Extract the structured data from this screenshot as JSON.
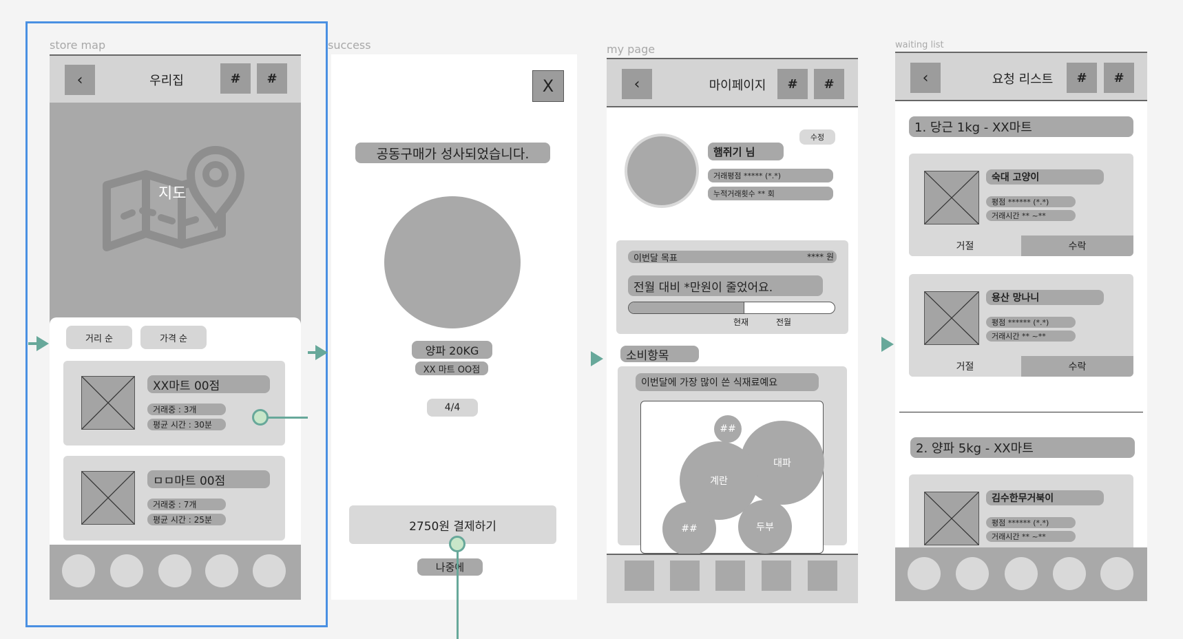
{
  "frames": {
    "store_map": {
      "label": "store map",
      "back": "‹",
      "title": "우리집",
      "hash1": "#",
      "hash2": "#",
      "map_label": "지도",
      "sort_distance": "거리 순",
      "sort_price": "가격 순",
      "stores": [
        {
          "name": "XX마트 00점",
          "trading": "거래중 : 3개",
          "avg_time": "평균 시간 : 30분"
        },
        {
          "name": "ㅁㅁ마트 00점",
          "trading": "거래중 : 7개",
          "avg_time": "평균 시간 : 25분"
        }
      ]
    },
    "success": {
      "label": "success",
      "close": "X",
      "message": "공동구매가 성사되었습니다.",
      "product": "양파 20KG",
      "store": "XX 마트 OO점",
      "count": "4/4",
      "pay_button": "2750원 결제하기",
      "later_button": "나중에"
    },
    "my_page": {
      "label": "my page",
      "back": "‹",
      "title": "마이페이지",
      "hash1": "#",
      "hash2": "#",
      "edit": "수정",
      "username": "햄쥐기 님",
      "rating": "거래평점 *****  (*.*)",
      "trade_count": "누적거래횟수 ** 회",
      "goal_label": "이번달 목표",
      "goal_value": "**** 원",
      "saving_message": "전월 대비 *만원이 줄었어요.",
      "progress": 0.56,
      "progress_current": "현재",
      "progress_prev": "전월",
      "spending_title": "소비항목",
      "spending_subtitle": "이번달에 가장 많이 쓴 식재료예요",
      "bubbles": [
        "##",
        "대파",
        "계란",
        "##",
        "두부"
      ]
    },
    "waiting_list": {
      "label": "waiting list",
      "back": "‹",
      "title": "요청 리스트",
      "hash1": "#",
      "hash2": "#",
      "groups": [
        {
          "title": "1. 당근 1kg - XX마트"
        },
        {
          "title": "2. 양파 5kg - XX마트"
        }
      ],
      "requests": [
        {
          "name": "숙대 고양이",
          "rating": "평점 ****** (*.*)",
          "time": "거래시간 ** ~**",
          "reject": "거절",
          "accept": "수락"
        },
        {
          "name": "용산 망나니",
          "rating": "평점 ****** (*.*)",
          "time": "거래시간 ** ~**",
          "reject": "거절",
          "accept": "수락"
        },
        {
          "name": "김수한무거북이",
          "rating": "평점 ****** (*.*)",
          "time": "거래시간 ** ~**"
        }
      ]
    }
  },
  "colors": {
    "selection": "#4a90e2",
    "connector": "#67a89a"
  }
}
